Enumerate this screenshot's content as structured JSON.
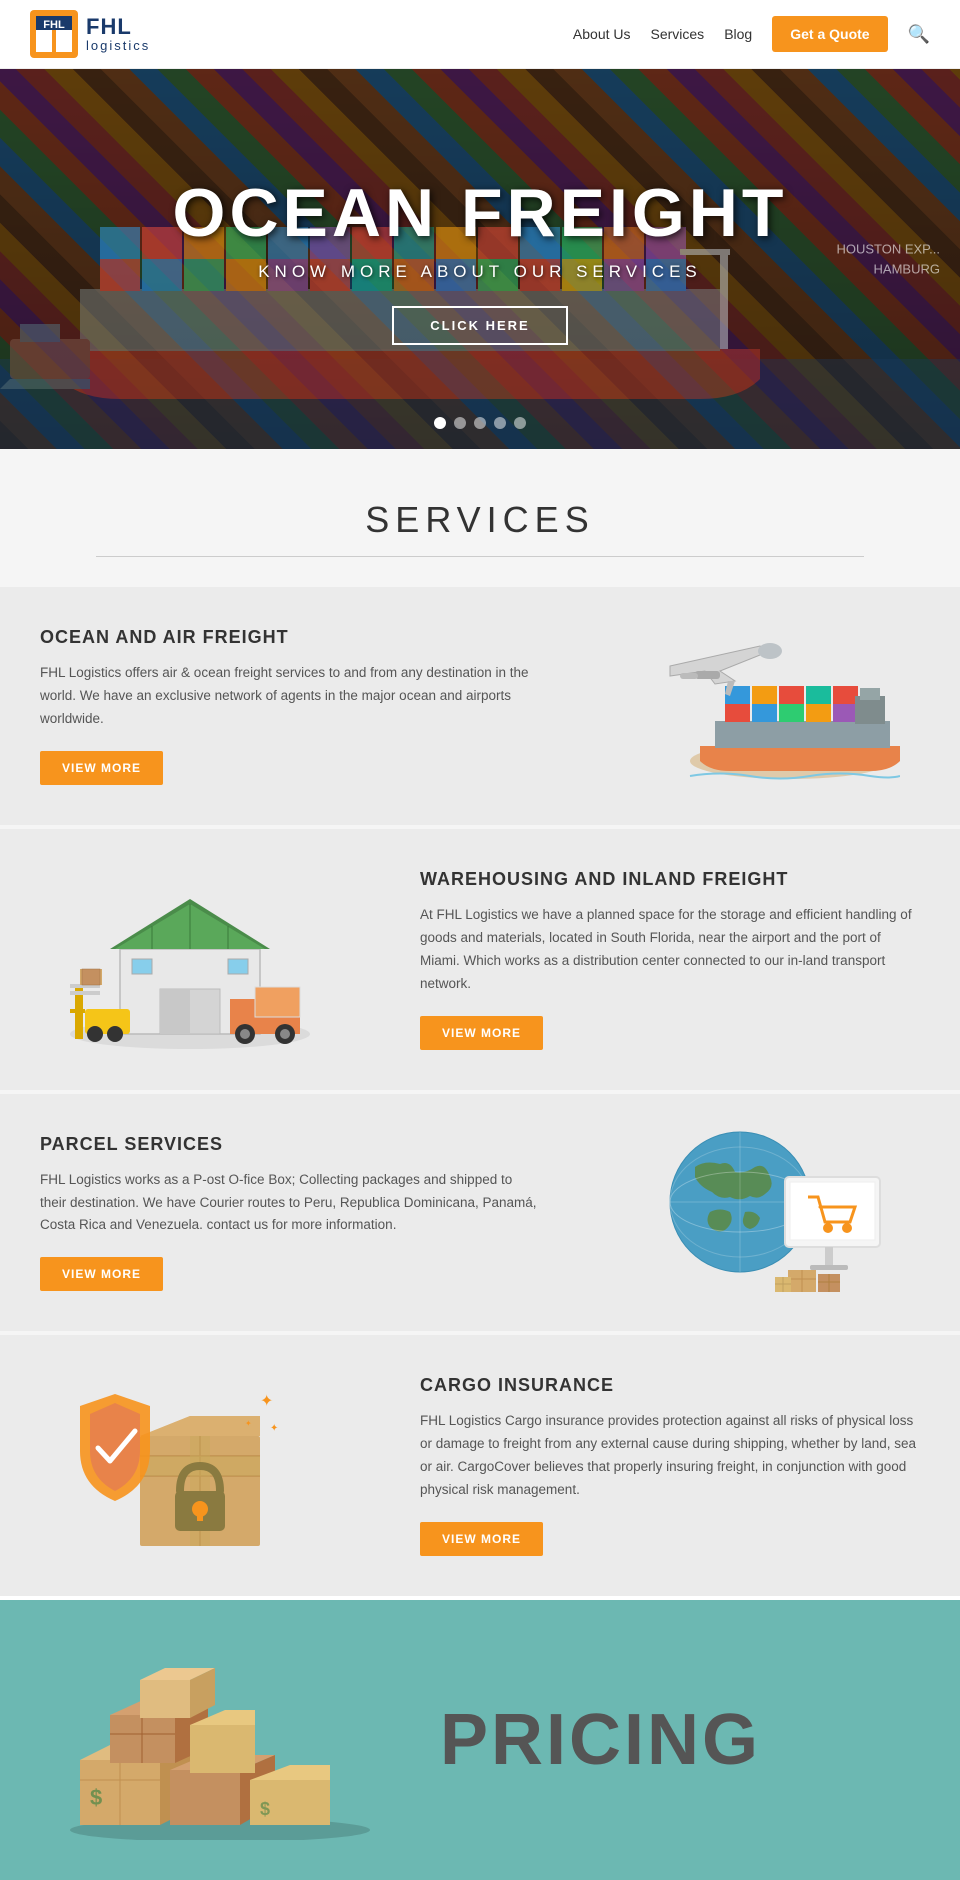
{
  "header": {
    "logo_fhl": "FHL",
    "logo_logistics": "logistics",
    "nav_about": "About Us",
    "nav_services": "Services",
    "nav_blog": "Blog",
    "btn_quote": "Get a Quote"
  },
  "hero": {
    "title": "OCEAN FREIGHT",
    "subtitle": "KNOW MORE ABOUT OUR SERVICES",
    "btn_label": "CLICK HERE",
    "watermark_line1": "HOUSTON EXP...",
    "watermark_line2": "HAMBURG",
    "dots": [
      true,
      false,
      false,
      false,
      false
    ]
  },
  "services": {
    "section_title": "SERVICES",
    "items": [
      {
        "name": "OCEAN AND AIR FREIGHT",
        "desc": "FHL Logistics offers air & ocean freight services to and from any destination in the world. We have an exclusive network of agents in the major ocean and airports worldwide.",
        "btn": "VIEW MORE",
        "icon": "ship-plane"
      },
      {
        "name": "WAREHOUSING AND INLAND FREIGHT",
        "desc": "At FHL Logistics we have a planned space for the storage and efficient handling of goods and materials, located in South Florida, near the airport and the port of Miami. Which works as a distribution center connected to our in-land transport network.",
        "btn": "VIEW MORE",
        "icon": "warehouse"
      },
      {
        "name": "PARCEL SERVICES",
        "desc": "FHL Logistics works as a P-ost O-fice Box; Collecting packages and shipped to their destination. We have Courier routes to Peru, Republica Dominicana, Panamá, Costa Rica and Venezuela. contact us for more information.",
        "btn": "VIEW MORE",
        "icon": "parcel-globe"
      },
      {
        "name": "CARGO INSURANCE",
        "desc": "FHL Logistics Cargo insurance provides protection against all risks of physical loss or damage to freight from any external cause during shipping, whether by land, sea or air. CargoCover believes that properly insuring freight, in conjunction with good physical risk management.",
        "btn": "VIEW MORE",
        "icon": "cargo-shield"
      }
    ]
  },
  "pricing": {
    "title": "PRICING"
  }
}
